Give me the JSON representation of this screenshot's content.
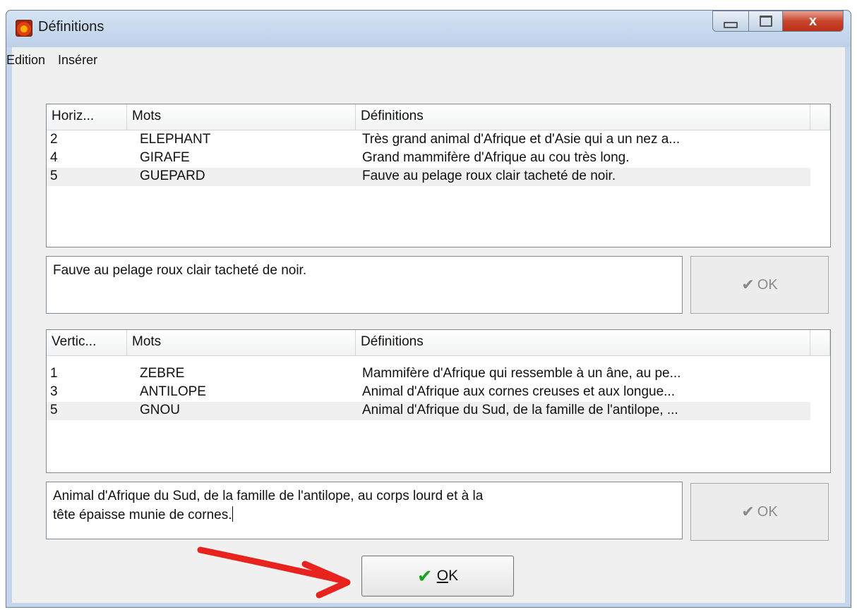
{
  "window": {
    "title": "Définitions",
    "close_glyph": "x"
  },
  "menu": {
    "items": [
      "Edition",
      "Insérer"
    ]
  },
  "horizontal": {
    "columns": [
      "Horiz...",
      "Mots",
      "Définitions"
    ],
    "rows": [
      {
        "num": "2",
        "mot": "ELEPHANT",
        "def": "Très grand animal d'Afrique et d'Asie qui a un nez a..."
      },
      {
        "num": "4",
        "mot": "GIRAFE",
        "def": "Grand mammifère d'Afrique au cou très long."
      },
      {
        "num": "5",
        "mot": "GUEPARD",
        "def": "Fauve au pelage roux clair tacheté de noir."
      }
    ],
    "selected_row": 2,
    "edit_text": "Fauve au pelage roux clair tacheté de noir.",
    "ok_label": "OK"
  },
  "vertical": {
    "columns": [
      "Vertic...",
      "Mots",
      "Définitions"
    ],
    "rows": [
      {
        "num": "1",
        "mot": "ZEBRE",
        "def": "Mammifère d'Afrique qui ressemble à un âne, au pe..."
      },
      {
        "num": "3",
        "mot": "ANTILOPE",
        "def": "Animal d'Afrique aux cornes creuses et aux longue..."
      },
      {
        "num": "5",
        "mot": "GNOU",
        "def": "Animal d'Afrique du Sud, de la famille de l'antilope, ..."
      }
    ],
    "selected_row": 2,
    "edit_line1": "Animal d'Afrique du Sud, de la famille de l'antilope, au corps lourd et à la",
    "edit_line2": "tête épaisse munie de cornes.",
    "ok_label": "OK"
  },
  "main_ok": {
    "accel": "O",
    "rest": "K"
  },
  "colors": {
    "accent_check": "#1aa31a",
    "arrow": "#e8231d",
    "close_button": "#c8452c"
  },
  "icons": [
    "app-icon",
    "minimize-icon",
    "maximize-icon",
    "close-icon",
    "check-icon",
    "arrow-annotation"
  ]
}
